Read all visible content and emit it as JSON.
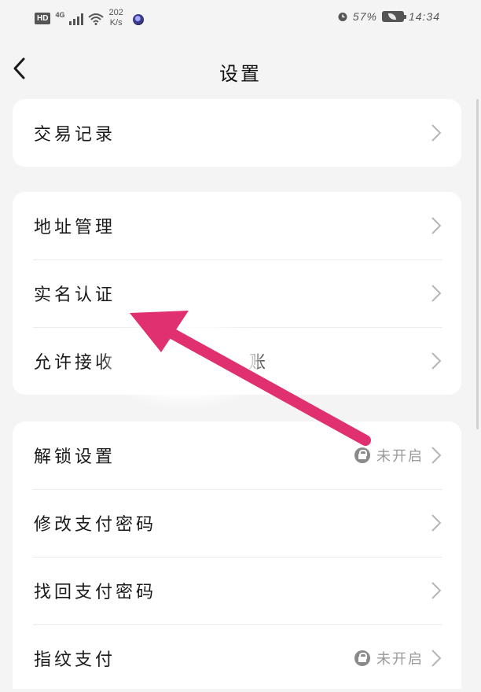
{
  "status_bar": {
    "hd_badge": "HD",
    "network": "4G",
    "speed_value": "202",
    "speed_unit": "K/s",
    "battery_percent": "57%",
    "time": "14:34"
  },
  "header": {
    "title": "设置"
  },
  "sections": [
    {
      "items": [
        {
          "label": "交易记录"
        }
      ]
    },
    {
      "items": [
        {
          "label": "地址管理"
        },
        {
          "label": "实名认证"
        },
        {
          "label": "允许接收",
          "label_tail": "账"
        }
      ]
    },
    {
      "items": [
        {
          "label": "解锁设置",
          "status": "未开启"
        },
        {
          "label": "修改支付密码"
        },
        {
          "label": "找回支付密码"
        },
        {
          "label": "指纹支付",
          "status": "未开启"
        }
      ]
    }
  ],
  "colors": {
    "background": "#f4f4f4",
    "card": "#ffffff",
    "annotation_arrow": "#e0306f"
  },
  "icons": [
    "back-chevron-icon",
    "chevron-right-icon",
    "lock-icon",
    "alarm-icon",
    "battery-icon",
    "wifi-icon",
    "signal-icon"
  ]
}
